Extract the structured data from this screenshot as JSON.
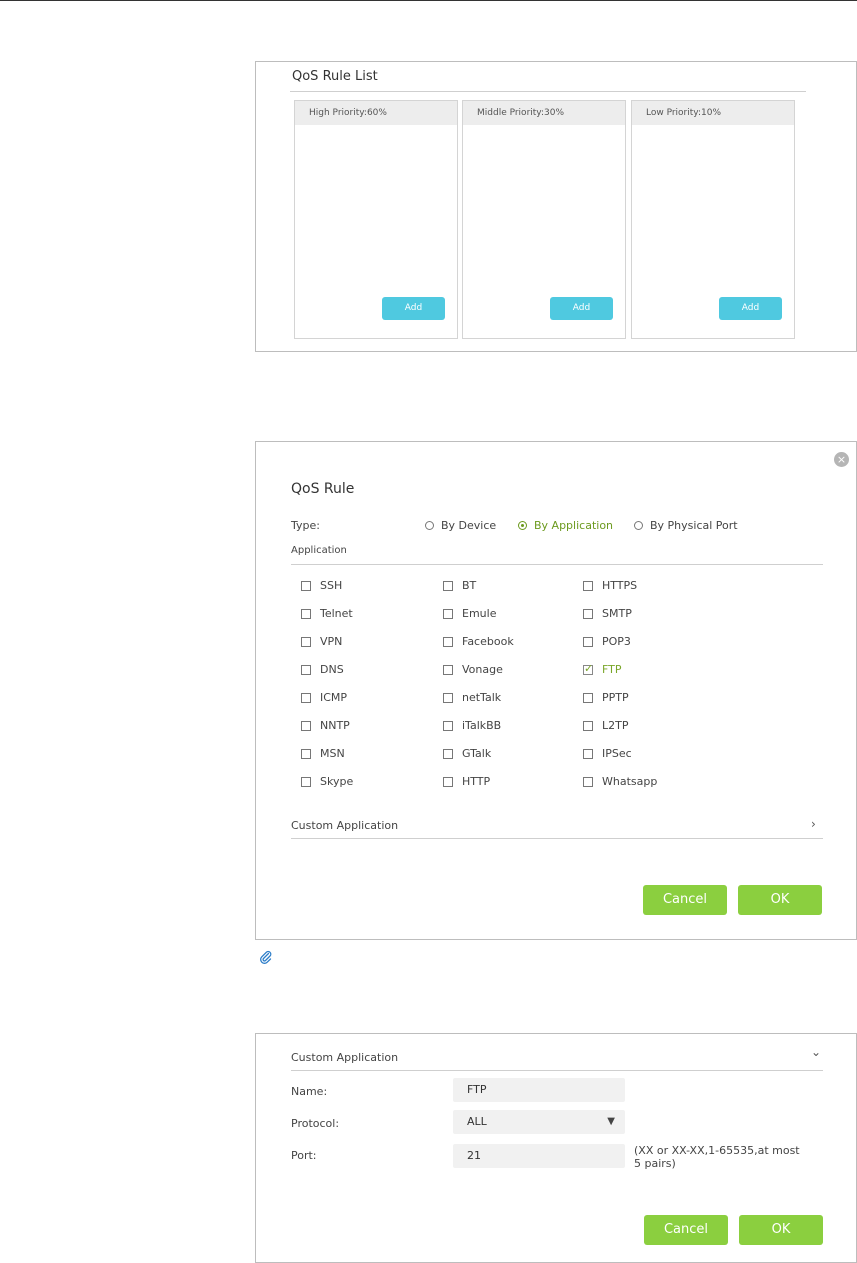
{
  "qos_rule_list": {
    "title": "QoS Rule List",
    "columns": [
      {
        "label": "High Priority:60%",
        "add_label": "Add"
      },
      {
        "label": "Middle Priority:30%",
        "add_label": "Add"
      },
      {
        "label": "Low Priority:10%",
        "add_label": "Add"
      }
    ]
  },
  "qos_rule": {
    "title": "QoS Rule",
    "close_icon": "×",
    "type_label": "Type:",
    "type_options": [
      {
        "label": "By Device",
        "selected": false
      },
      {
        "label": "By Application",
        "selected": true
      },
      {
        "label": "By Physical Port",
        "selected": false
      }
    ],
    "application_label": "Application",
    "applications": [
      {
        "label": "SSH",
        "checked": false
      },
      {
        "label": "BT",
        "checked": false
      },
      {
        "label": "HTTPS",
        "checked": false
      },
      {
        "label": "Telnet",
        "checked": false
      },
      {
        "label": "Emule",
        "checked": false
      },
      {
        "label": "SMTP",
        "checked": false
      },
      {
        "label": "VPN",
        "checked": false
      },
      {
        "label": "Facebook",
        "checked": false
      },
      {
        "label": "POP3",
        "checked": false
      },
      {
        "label": "DNS",
        "checked": false
      },
      {
        "label": "Vonage",
        "checked": false
      },
      {
        "label": "FTP",
        "checked": true
      },
      {
        "label": "ICMP",
        "checked": false
      },
      {
        "label": "netTalk",
        "checked": false
      },
      {
        "label": "PPTP",
        "checked": false
      },
      {
        "label": "NNTP",
        "checked": false
      },
      {
        "label": "iTalkBB",
        "checked": false
      },
      {
        "label": "L2TP",
        "checked": false
      },
      {
        "label": "MSN",
        "checked": false
      },
      {
        "label": "GTalk",
        "checked": false
      },
      {
        "label": "IPSec",
        "checked": false
      },
      {
        "label": "Skype",
        "checked": false
      },
      {
        "label": "HTTP",
        "checked": false
      },
      {
        "label": "Whatsapp",
        "checked": false
      }
    ],
    "custom_application_label": "Custom Application",
    "chevron": "›",
    "cancel_label": "Cancel",
    "ok_label": "OK"
  },
  "note_icon": "paperclip-icon",
  "custom_application": {
    "title": "Custom Application",
    "chevron": "⌄",
    "name_label": "Name:",
    "name_value": "FTP",
    "protocol_label": "Protocol:",
    "protocol_value": "ALL",
    "port_label": "Port:",
    "port_value": "21",
    "port_hint": "(XX or XX-XX,1-65535,at most 5 pairs)",
    "cancel_label": "Cancel",
    "ok_label": "OK"
  },
  "colors": {
    "accent_green": "#8bcf3f",
    "add_blue": "#4fc9e0",
    "selected_green": "#6c9a1e"
  }
}
